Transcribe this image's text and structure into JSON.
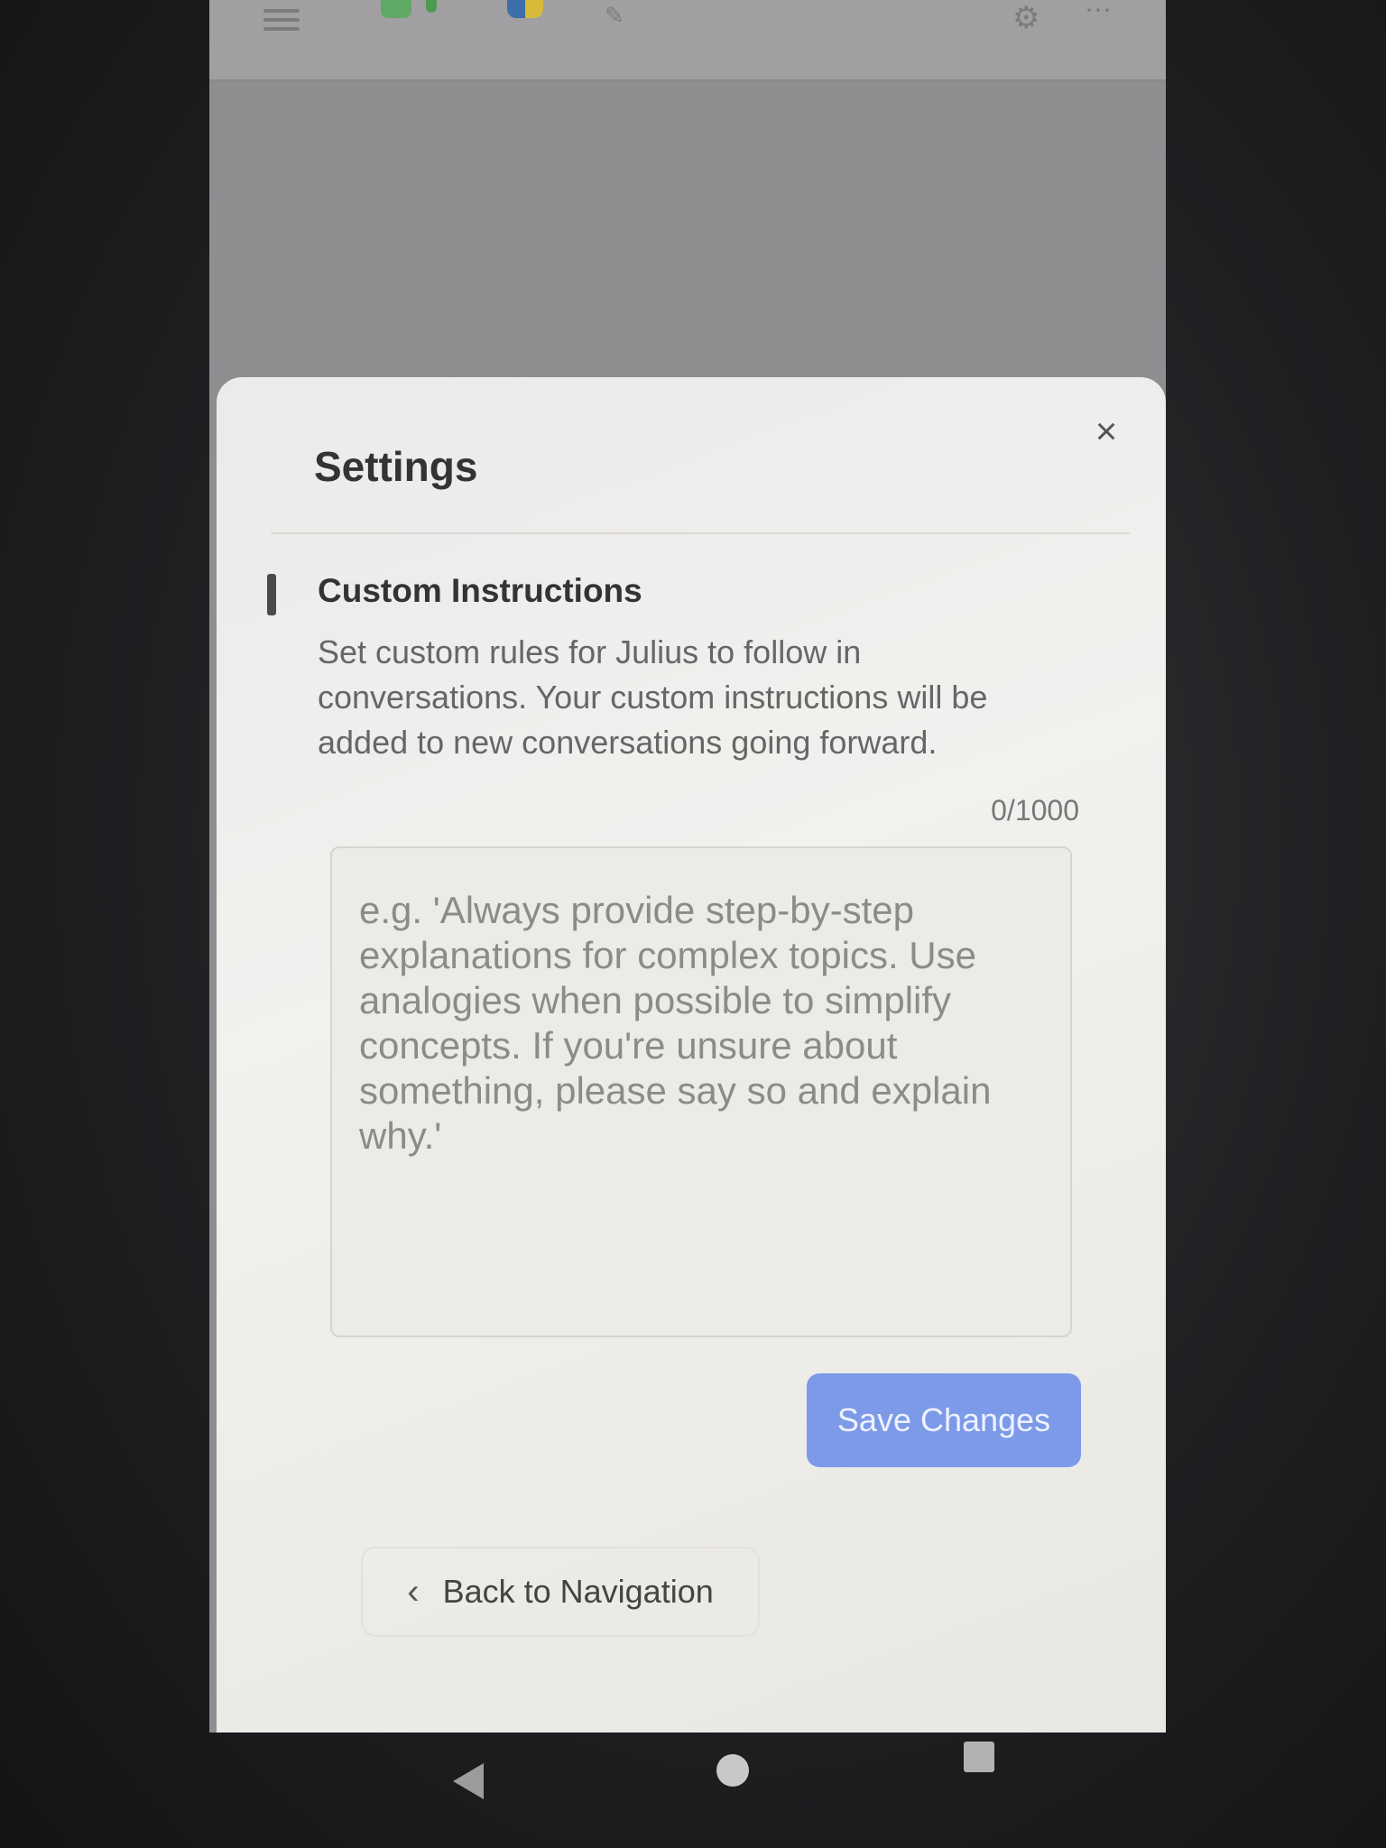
{
  "topbar": {
    "icons": [
      "menu-icon",
      "sheets-icon",
      "python-icon",
      "edit-icon",
      "gear-icon",
      "more-icon"
    ]
  },
  "modal": {
    "title": "Settings",
    "close_icon": "×",
    "section": {
      "title": "Custom Instructions",
      "description": "Set custom rules for Julius to follow in conversations. Your custom instructions will be added to new conversations going forward."
    },
    "counter": "0/1000",
    "textarea": {
      "value": "",
      "placeholder": "e.g. 'Always provide step-by-step explanations for complex topics. Use analogies when possible to simplify concepts. If you're unsure about something, please say so and explain why.'"
    },
    "save_label": "Save Changes",
    "back_chevron": "‹",
    "back_label": "Back to Navigation"
  },
  "colors": {
    "accent": "#7d9ae8",
    "modal_bg": "#eeede9",
    "overlay": "#8f8d90"
  },
  "system_nav": {
    "icons": [
      "back-triangle-icon",
      "home-circle-icon",
      "recents-square-icon"
    ]
  }
}
